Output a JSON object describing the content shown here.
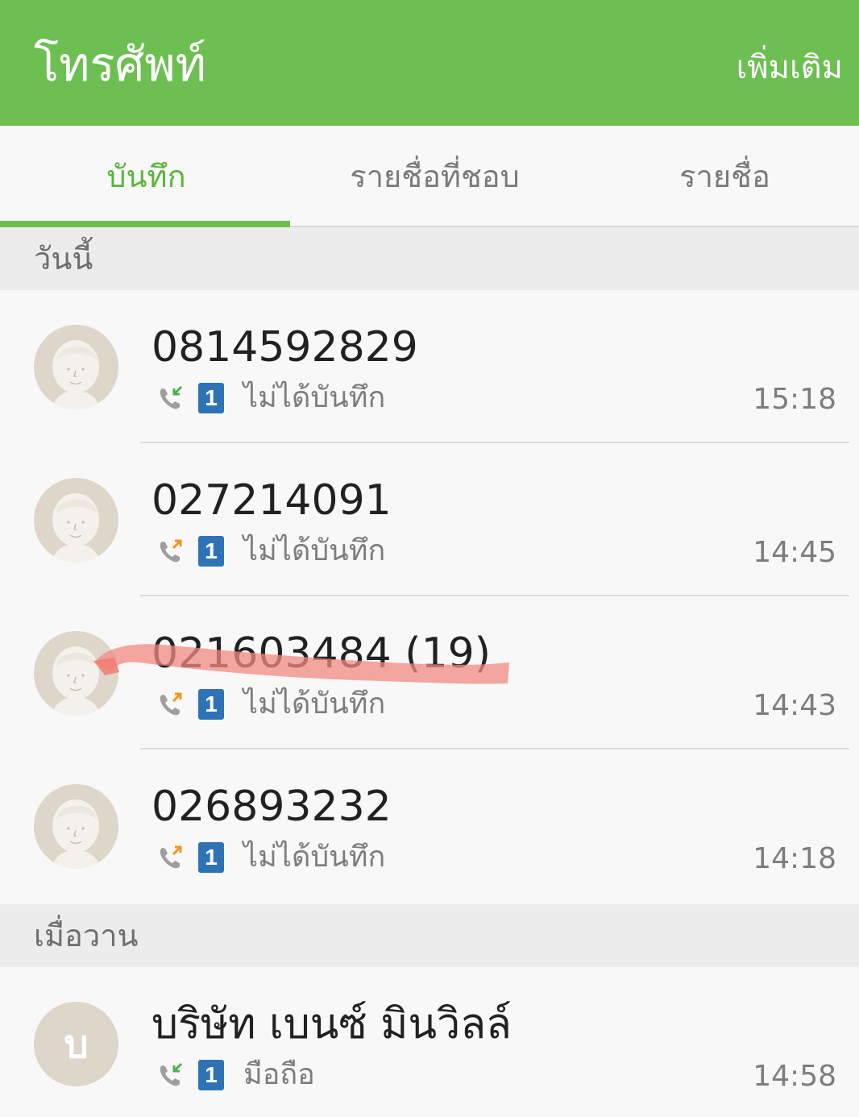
{
  "appbar": {
    "title": "โทรศัพท์",
    "more_label": "เพิ่มเติม",
    "color": "#6dbf52"
  },
  "tabs": [
    {
      "label": "บันทึก",
      "active": true
    },
    {
      "label": "รายชื่อที่ชอบ",
      "active": false
    },
    {
      "label": "รายชื่อ",
      "active": false
    }
  ],
  "sections": [
    {
      "header": "วันนี้",
      "items": [
        {
          "name": "0814592829",
          "call_type": "incoming",
          "sim": "1",
          "status": "ไม่ได้บันทึก",
          "time": "15:18"
        },
        {
          "name": "027214091",
          "call_type": "outgoing",
          "sim": "1",
          "status": "ไม่ได้บันทึก",
          "time": "14:45"
        },
        {
          "name": "021603484 (19)",
          "call_type": "outgoing",
          "sim": "1",
          "status": "ไม่ได้บันทึก",
          "time": "14:43"
        },
        {
          "name": "026893232",
          "call_type": "outgoing",
          "sim": "1",
          "status": "ไม่ได้บันทึก",
          "time": "14:18"
        }
      ]
    },
    {
      "header": "เมื่อวาน",
      "items": [
        {
          "name": "บริษัท เบนซ์ มินวิลล์",
          "avatar_letter": "บ",
          "call_type": "incoming",
          "sim": "1",
          "status": "มือถือ",
          "time": "14:58"
        }
      ]
    }
  ],
  "icons": {
    "incoming_call": "incoming-call-icon",
    "outgoing_call": "outgoing-call-icon",
    "sim": "sim-1-badge",
    "avatar": "default-person-avatar"
  },
  "colors": {
    "accent": "#6dbf52",
    "incoming_arrow": "#4caf50",
    "outgoing_arrow": "#f0961e",
    "sim_badge": "#2f73b7",
    "highlight_scribble": "#f28b82"
  }
}
